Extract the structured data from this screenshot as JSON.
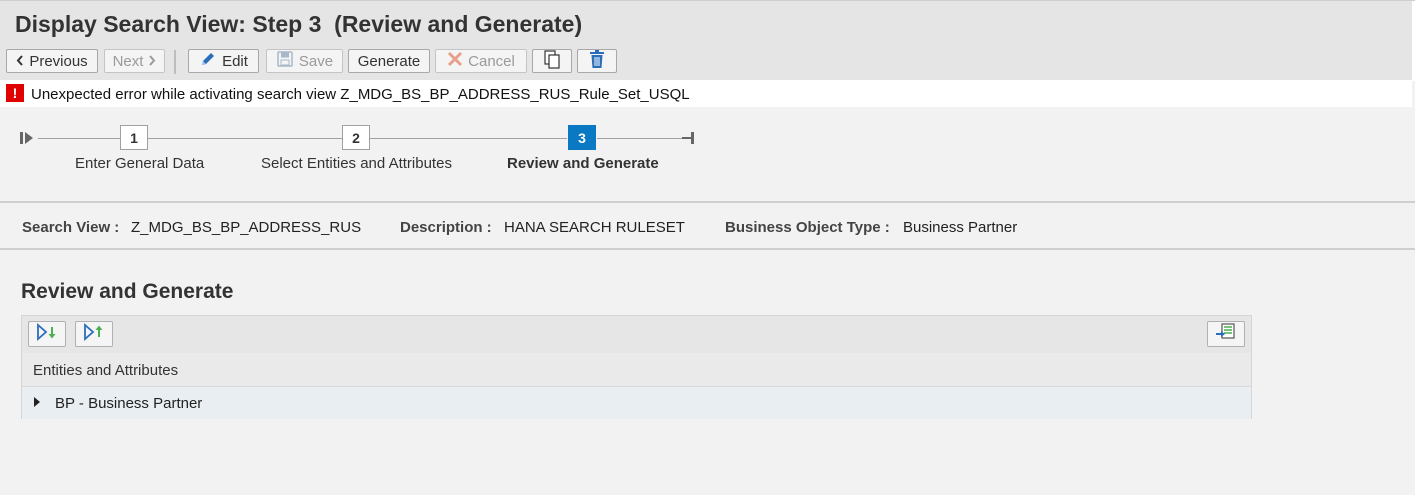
{
  "page": {
    "title": "Display Search View: Step 3  (Review and Generate)"
  },
  "toolbar": {
    "previous_label": "Previous",
    "next_label": "Next",
    "edit_label": "Edit",
    "save_label": "Save",
    "generate_label": "Generate",
    "cancel_label": "Cancel"
  },
  "message": {
    "type": "error",
    "icon": "!",
    "text": "Unexpected error while activating search view Z_MDG_BS_BP_ADDRESS_RUS_Rule_Set_USQL"
  },
  "roadmap": {
    "steps": [
      {
        "number": "1",
        "label": "Enter General Data",
        "active": false
      },
      {
        "number": "2",
        "label": "Select Entities and Attributes",
        "active": false
      },
      {
        "number": "3",
        "label": "Review and Generate",
        "active": true
      }
    ]
  },
  "info": {
    "search_view_label": "Search View :",
    "search_view_value": "Z_MDG_BS_BP_ADDRESS_RUS",
    "description_label": "Description :",
    "description_value": "HANA SEARCH RULESET",
    "bo_type_label": "Business Object Type :",
    "bo_type_value": "Business Partner"
  },
  "section": {
    "title": "Review and Generate"
  },
  "table": {
    "column_header": "Entities and Attributes",
    "rows": [
      {
        "label": "BP - Business Partner",
        "expanded": false
      }
    ]
  },
  "colors": {
    "active_step": "#0a78c2",
    "error": "#e00000",
    "edit_icon": "#2a6ebb",
    "delete_icon": "#2a6ebb"
  }
}
